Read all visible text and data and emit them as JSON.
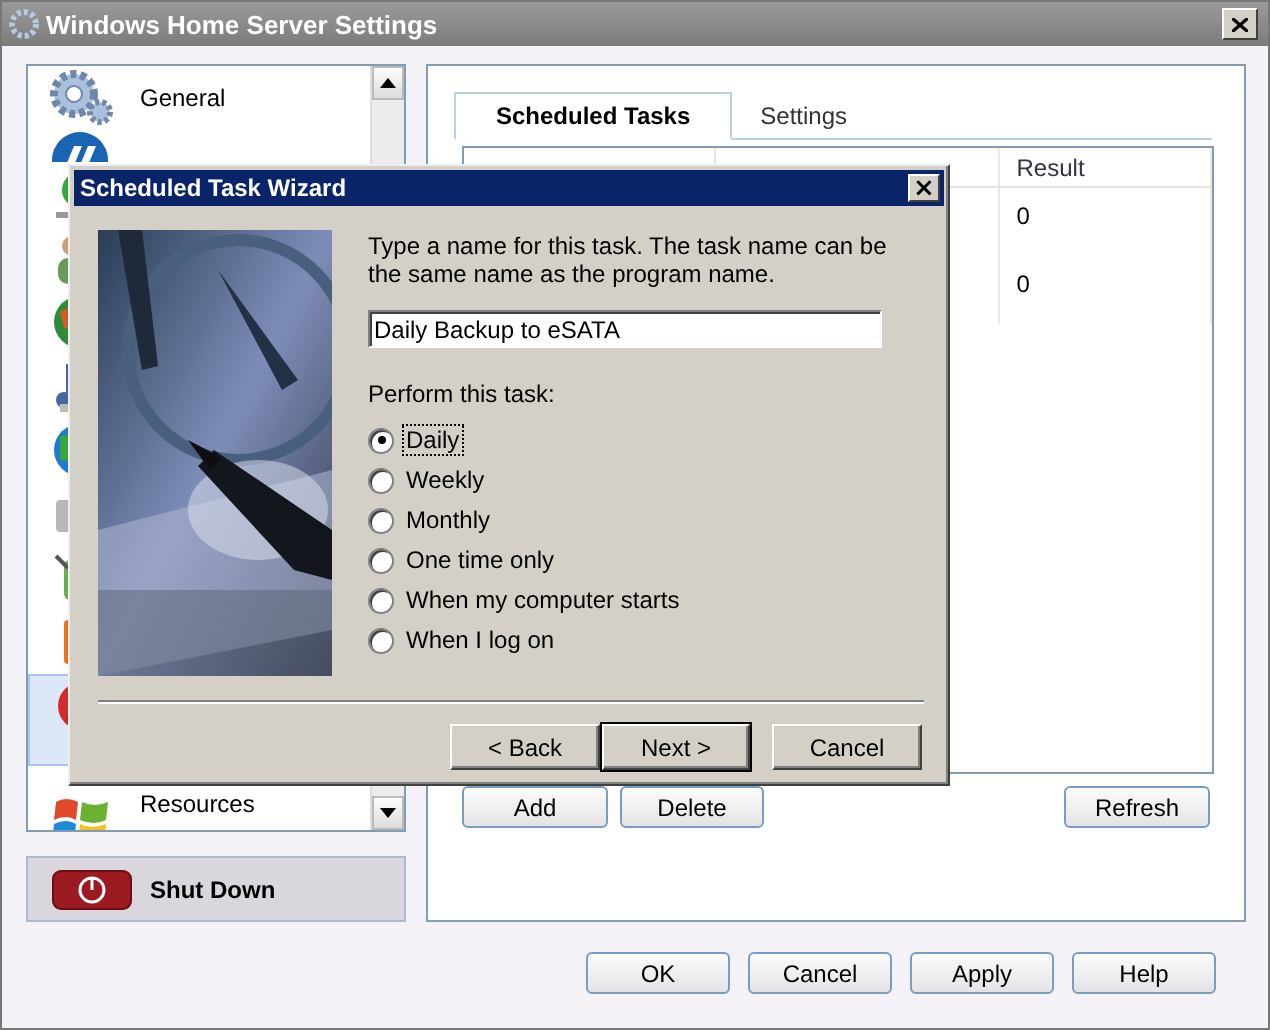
{
  "window": {
    "title": "Windows Home Server Settings"
  },
  "sidebar": {
    "items": [
      {
        "label": "General",
        "selected": false
      },
      {
        "selected": false
      },
      {
        "selected": false
      },
      {
        "selected": false
      },
      {
        "selected": false
      },
      {
        "selected": false
      },
      {
        "selected": false
      },
      {
        "selected": false
      },
      {
        "selected": false
      },
      {
        "selected": false
      },
      {
        "selected": true
      },
      {
        "label": "Resources",
        "selected": false
      }
    ]
  },
  "shutdown_button": {
    "label": "Shut Down"
  },
  "tabs": [
    {
      "label": "Scheduled Tasks",
      "selected": true
    },
    {
      "label": "Settings",
      "selected": false
    }
  ],
  "table": {
    "columns": [
      "",
      "",
      "Result"
    ],
    "rows": [
      [
        "",
        "",
        "0"
      ],
      [
        "",
        "",
        "0"
      ]
    ]
  },
  "task_buttons": [
    "Add",
    "Delete",
    "Refresh"
  ],
  "dialog_buttons": [
    "OK",
    "Cancel",
    "Apply",
    "Help"
  ],
  "wizard": {
    "title": "Scheduled Task Wizard",
    "close": "×",
    "instruction": "Type a name for this task.  The task name can be the same name as the program name.",
    "name_field": {
      "value": "Daily Backup to eSATA"
    },
    "perform_label": "Perform this task:",
    "options": [
      {
        "label": "Daily",
        "selected": true
      },
      {
        "label": "Weekly",
        "selected": false
      },
      {
        "label": "Monthly",
        "selected": false
      },
      {
        "label": "One time only",
        "selected": false
      },
      {
        "label": "When my computer starts",
        "selected": false
      },
      {
        "label": "When I log on",
        "selected": false
      }
    ],
    "buttons": [
      {
        "label": "< Back",
        "default": false
      },
      {
        "label": "Next >",
        "default": true
      },
      {
        "label": "Cancel",
        "default": false
      }
    ]
  }
}
